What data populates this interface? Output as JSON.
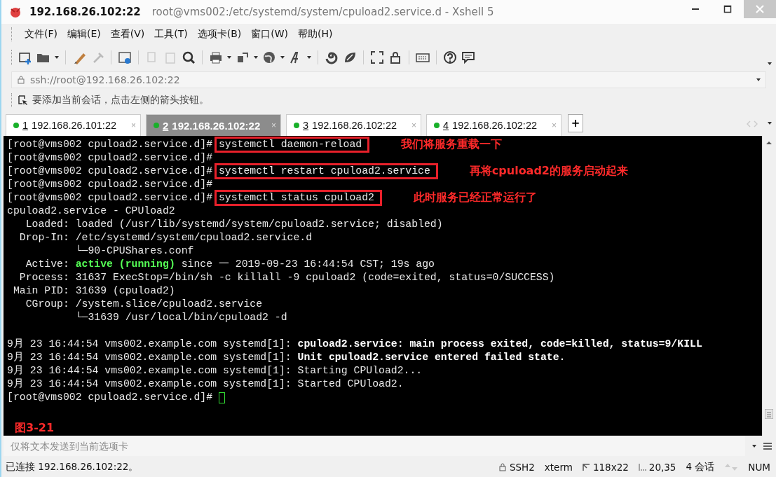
{
  "window": {
    "host": "192.168.26.102:22",
    "title": "root@vms002:/etc/systemd/system/cpuload2.service.d - Xshell 5"
  },
  "menu": [
    "文件(F)",
    "编辑(E)",
    "查看(V)",
    "工具(T)",
    "选项卡(B)",
    "窗口(W)",
    "帮助(H)"
  ],
  "address": {
    "value": "ssh://root@192.168.26.102:22"
  },
  "hint": "要添加当前会话，点击左侧的箭头按钮。",
  "tabs": [
    {
      "number": "1",
      "label": "192.168.26.101:22",
      "close": "×",
      "selected": false
    },
    {
      "number": "2",
      "label": "192.168.26.102:22",
      "close": "×",
      "selected": true
    },
    {
      "number": "3",
      "label": "192.168.26.102:22",
      "close": "×",
      "selected": false
    },
    {
      "number": "4",
      "label": "192.168.26.102:22",
      "close": "×",
      "selected": false
    }
  ],
  "new_tab": "+",
  "terminal": {
    "lines": [
      {
        "segments": [
          {
            "kind": "plain",
            "text": "[root@vms002 cpuload2.service.d]# "
          },
          {
            "kind": "boxed",
            "text": "systemctl daemon-reload"
          }
        ],
        "note": "我们将服务重载一下"
      },
      {
        "segments": [
          {
            "kind": "plain",
            "text": "[root@vms002 cpuload2.service.d]#"
          }
        ]
      },
      {
        "segments": [
          {
            "kind": "plain",
            "text": "[root@vms002 cpuload2.service.d]# "
          },
          {
            "kind": "boxed",
            "text": "systemctl restart cpuload2.service"
          }
        ],
        "note": "再将cpuload2的服务启动起来"
      },
      {
        "segments": [
          {
            "kind": "plain",
            "text": "[root@vms002 cpuload2.service.d]#"
          }
        ]
      },
      {
        "segments": [
          {
            "kind": "plain",
            "text": "[root@vms002 cpuload2.service.d]# "
          },
          {
            "kind": "boxed",
            "text": "systemctl status cpuload2"
          }
        ],
        "note": "此时服务已经正常运行了"
      },
      {
        "segments": [
          {
            "kind": "plain",
            "text": "cpuload2.service - CPUload2"
          }
        ]
      },
      {
        "segments": [
          {
            "kind": "plain",
            "text": "   Loaded: loaded (/usr/lib/systemd/system/cpuload2.service; disabled)"
          }
        ]
      },
      {
        "segments": [
          {
            "kind": "plain",
            "text": "  Drop-In: /etc/systemd/system/cpuload2.service.d"
          }
        ]
      },
      {
        "segments": [
          {
            "kind": "plain",
            "text": "           └─90-CPUShares.conf"
          }
        ]
      },
      {
        "segments": [
          {
            "kind": "plain",
            "text": "   Active: "
          },
          {
            "kind": "green",
            "text": "active (running)"
          },
          {
            "kind": "plain",
            "text": " since 一 2019-09-23 16:44:54 CST; 19s ago"
          }
        ]
      },
      {
        "segments": [
          {
            "kind": "plain",
            "text": "  Process: 31637 ExecStop=/bin/sh -c killall -9 cpuload2 (code=exited, status=0/SUCCESS)"
          }
        ]
      },
      {
        "segments": [
          {
            "kind": "plain",
            "text": " Main PID: 31639 (cpuload2)"
          }
        ]
      },
      {
        "segments": [
          {
            "kind": "plain",
            "text": "   CGroup: /system.slice/cpuload2.service"
          }
        ]
      },
      {
        "segments": [
          {
            "kind": "plain",
            "text": "           └─31639 /usr/local/bin/cpuload2 -d"
          }
        ]
      },
      {
        "blank_before": true,
        "segments": [
          {
            "kind": "plain",
            "text": "9月 23 16:44:54 vms002.example.com systemd[1]: "
          },
          {
            "kind": "bold",
            "text": "cpuload2.service: main process exited, code=killed, status=9/KILL"
          }
        ]
      },
      {
        "segments": [
          {
            "kind": "plain",
            "text": "9月 23 16:44:54 vms002.example.com systemd[1]: "
          },
          {
            "kind": "bold",
            "text": "Unit cpuload2.service entered failed state."
          }
        ]
      },
      {
        "segments": [
          {
            "kind": "plain",
            "text": "9月 23 16:44:54 vms002.example.com systemd[1]: Starting CPUload2..."
          }
        ]
      },
      {
        "segments": [
          {
            "kind": "plain",
            "text": "9月 23 16:44:54 vms002.example.com systemd[1]: Started CPUload2."
          }
        ]
      },
      {
        "segments": [
          {
            "kind": "plain",
            "text": "[root@vms002 cpuload2.service.d]# "
          }
        ],
        "cursor": true
      }
    ],
    "figure_label": "图3-21"
  },
  "send_bar": {
    "placeholder": "仅将文本发送到当前选项卡"
  },
  "status_bar": {
    "connection": "已连接 192.168.26.102:22。",
    "items": [
      {
        "kind": "lock",
        "text": "SSH2"
      },
      {
        "kind": "plain",
        "text": "xterm"
      },
      {
        "kind": "size",
        "text": "118x22"
      },
      {
        "kind": "position",
        "text": "20,35"
      },
      {
        "kind": "plain",
        "text": "4 会话"
      },
      {
        "kind": "arrows"
      },
      {
        "kind": "plain",
        "text": "NUM"
      }
    ]
  }
}
